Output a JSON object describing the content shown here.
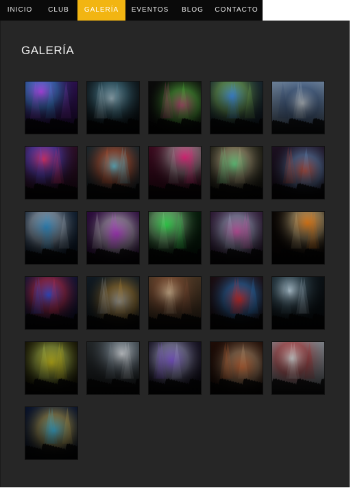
{
  "nav": {
    "items": [
      {
        "label": "INICIO",
        "active": false
      },
      {
        "label": "CLUB",
        "active": false
      },
      {
        "label": "GALERÍA",
        "active": true
      },
      {
        "label": "EVENTOS",
        "active": false
      },
      {
        "label": "BLOG",
        "active": false
      },
      {
        "label": "CONTACTO",
        "active": false
      }
    ]
  },
  "page": {
    "title": "GALERÍA"
  },
  "gallery": {
    "accent_color": "#f2b512",
    "photos": [
      {
        "name": "dj-purple-stage",
        "bg": "#2a0f4a",
        "glow": "#c34cff",
        "glow2": "#3fb0ff"
      },
      {
        "name": "pyramid-light-stage",
        "bg": "#0b1216",
        "glow": "#b8d4e0",
        "glow2": "#5fa0b8"
      },
      {
        "name": "neon-triangles-stage",
        "bg": "#0a0a0a",
        "glow": "#ff4fa0",
        "glow2": "#7cff5a"
      },
      {
        "name": "dj-arms-raised",
        "bg": "#14202a",
        "glow": "#4aa0ff",
        "glow2": "#9be36a"
      },
      {
        "name": "dj-tent-crowd",
        "bg": "#6a7e96",
        "glow": "#e0e8f0",
        "glow2": "#2b4a7a"
      },
      {
        "name": "mouse-head-red",
        "bg": "#2a0d22",
        "glow": "#ff3a7a",
        "glow2": "#6a5aff"
      },
      {
        "name": "laser-crowd-cyan",
        "bg": "#16242a",
        "glow": "#7fe8ff",
        "glow2": "#ff6a3a"
      },
      {
        "name": "dj-hands-mixer",
        "bg": "#3a0a1e",
        "glow": "#ff2a8a",
        "glow2": "#c0c0c0"
      },
      {
        "name": "club-bar-interior",
        "bg": "#1a1a12",
        "glow": "#7effa0",
        "glow2": "#e9d7a8"
      },
      {
        "name": "mouse-head-stage",
        "bg": "#1c1020",
        "glow": "#ff5a3a",
        "glow2": "#8ac0ff"
      },
      {
        "name": "blue-club-booth",
        "bg": "#0d1a2a",
        "glow": "#3aa0e0",
        "glow2": "#e0f0ff"
      },
      {
        "name": "purple-light-beams",
        "bg": "#2a0a3a",
        "glow": "#e04cff",
        "glow2": "#ffffff"
      },
      {
        "name": "green-laser-show",
        "bg": "#061a0a",
        "glow": "#38ff5a",
        "glow2": "#b0ffb0"
      },
      {
        "name": "pink-dj-stage",
        "bg": "#2a1630",
        "glow": "#ff6ad0",
        "glow2": "#d0e0ff"
      },
      {
        "name": "mouse-head-orange",
        "bg": "#0a0604",
        "glow": "#ff8a1a",
        "glow2": "#ffe0a0"
      },
      {
        "name": "blue-red-crowd",
        "bg": "#0e1230",
        "glow": "#4060ff",
        "glow2": "#ff3a5a"
      },
      {
        "name": "arena-crowd-night",
        "bg": "#101a22",
        "glow": "#d0d8e0",
        "glow2": "#f0b040"
      },
      {
        "name": "crowd-closeup",
        "bg": "#403020",
        "glow": "#e8c8a0",
        "glow2": "#a06040"
      },
      {
        "name": "red-stage-blue-chevron",
        "bg": "#1a0c10",
        "glow": "#ff3a3a",
        "glow2": "#3aa0ff"
      },
      {
        "name": "white-light-bars",
        "bg": "#0a1014",
        "glow": "#d8f0ff",
        "glow2": "#5a7a8a"
      },
      {
        "name": "yellow-beams-crowd",
        "bg": "#141204",
        "glow": "#f0e020",
        "glow2": "#e8ff6a"
      },
      {
        "name": "dj-controller",
        "bg": "#202426",
        "glow": "#e0e4e8",
        "glow2": "#8a9aa8"
      },
      {
        "name": "purple-arena-crowd",
        "bg": "#120e1c",
        "glow": "#9a6aff",
        "glow2": "#d0d0ff"
      },
      {
        "name": "orange-crowd-dj",
        "bg": "#1e0c06",
        "glow": "#ff7a3a",
        "glow2": "#ffd0a0"
      },
      {
        "name": "white-haze-crowd",
        "bg": "#7a7e84",
        "glow": "#f4f4f4",
        "glow2": "#c02020"
      },
      {
        "name": "city-stage-crowd",
        "bg": "#08122a",
        "glow": "#4ad0ff",
        "glow2": "#ffe06a"
      }
    ]
  }
}
